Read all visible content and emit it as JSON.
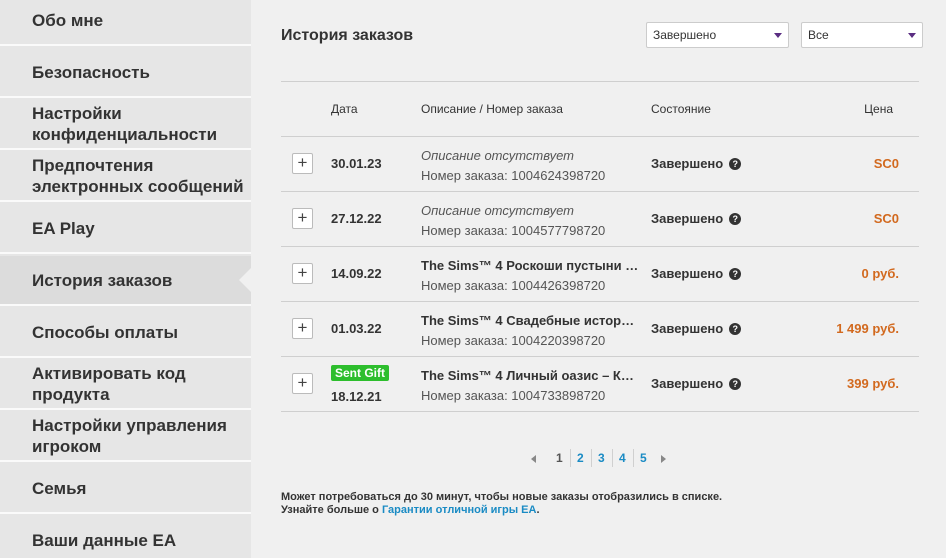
{
  "sidebar": {
    "items": [
      {
        "label": "Обо мне"
      },
      {
        "label": "Безопасность"
      },
      {
        "label": "Настройки конфиденциальности"
      },
      {
        "label": "Предпочтения электронных сообщений"
      },
      {
        "label": "EA Play"
      },
      {
        "label": "История заказов"
      },
      {
        "label": "Способы оплаты"
      },
      {
        "label": "Активировать код продукта"
      },
      {
        "label": "Настройки управления игроком"
      },
      {
        "label": "Семья"
      },
      {
        "label": "Ваши данные EA"
      }
    ]
  },
  "main": {
    "title": "История заказов",
    "status_filter": "Завершено",
    "type_filter": "Все",
    "columns": {
      "date": "Дата",
      "description": "Описание / Номер заказа",
      "status": "Состояние",
      "price": "Цена"
    },
    "orders": [
      {
        "date": "30.01.23",
        "description": "Описание отсутствует",
        "order_no": "Номер заказа: 1004624398720",
        "status": "Завершено",
        "price": "SC0"
      },
      {
        "date": "27.12.22",
        "description": "Описание отсутствует",
        "order_no": "Номер заказа: 1004577798720",
        "status": "Завершено",
        "price": "SC0"
      },
      {
        "date": "14.09.22",
        "description": "The Sims™ 4 Роскоши пустыни …",
        "order_no": "Номер заказа: 1004426398720",
        "status": "Завершено",
        "price": "0 руб."
      },
      {
        "date": "01.03.22",
        "description": "The Sims™ 4 Свадебные истор…",
        "order_no": "Номер заказа: 1004220398720",
        "status": "Завершено",
        "price": "1 499 руб."
      },
      {
        "date": "18.12.21",
        "badge": "Sent Gift",
        "description": "The Sims™ 4 Личный оазис – К…",
        "order_no": "Номер заказа: 1004733898720",
        "status": "Завершено",
        "price": "399 руб."
      }
    ],
    "pagination": {
      "pages": [
        "1",
        "2",
        "3",
        "4",
        "5"
      ],
      "current": "1"
    },
    "note_line1": "Может потребоваться до 30 минут, чтобы новые заказы отобразились в списке.",
    "note_line2_prefix": "Узнайте больше о ",
    "note_link": "Гарантии отличной игры EA",
    "note_line2_suffix": "."
  }
}
